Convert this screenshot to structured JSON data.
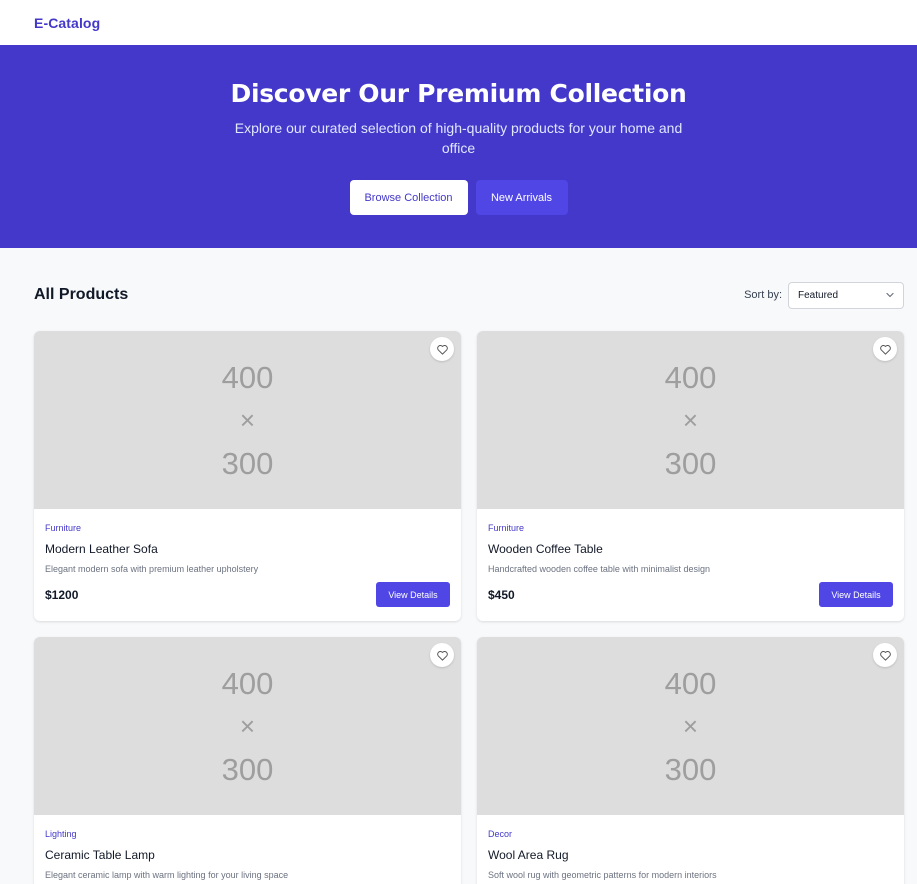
{
  "header": {
    "brand": "E-Catalog"
  },
  "hero": {
    "title": "Discover Our Premium Collection",
    "subtitle": "Explore our curated selection of high-quality products for your home and office",
    "primary_button": "Browse Collection",
    "secondary_button": "New Arrivals"
  },
  "products_section": {
    "title": "All Products",
    "sort_label": "Sort by:",
    "sort_value": "Featured"
  },
  "placeholder": {
    "width": "400",
    "times": "×",
    "height": "300"
  },
  "products": [
    {
      "category": "Furniture",
      "name": "Modern Leather Sofa",
      "description": "Elegant modern sofa with premium leather upholstery",
      "price": "$1200",
      "button": "View Details"
    },
    {
      "category": "Furniture",
      "name": "Wooden Coffee Table",
      "description": "Handcrafted wooden coffee table with minimalist design",
      "price": "$450",
      "button": "View Details"
    },
    {
      "category": "Lighting",
      "name": "Ceramic Table Lamp",
      "description": "Elegant ceramic lamp with warm lighting for your living space",
      "price": "",
      "button": ""
    },
    {
      "category": "Decor",
      "name": "Wool Area Rug",
      "description": "Soft wool rug with geometric patterns for modern interiors",
      "price": "",
      "button": ""
    }
  ],
  "colors": {
    "brand": "#4338ca",
    "button": "#4f46e5",
    "placeholder_bg": "#dddddd",
    "page_bg": "#f8f9fb"
  },
  "icons": {
    "favorite": "heart-icon",
    "dropdown": "chevron-down-icon"
  }
}
